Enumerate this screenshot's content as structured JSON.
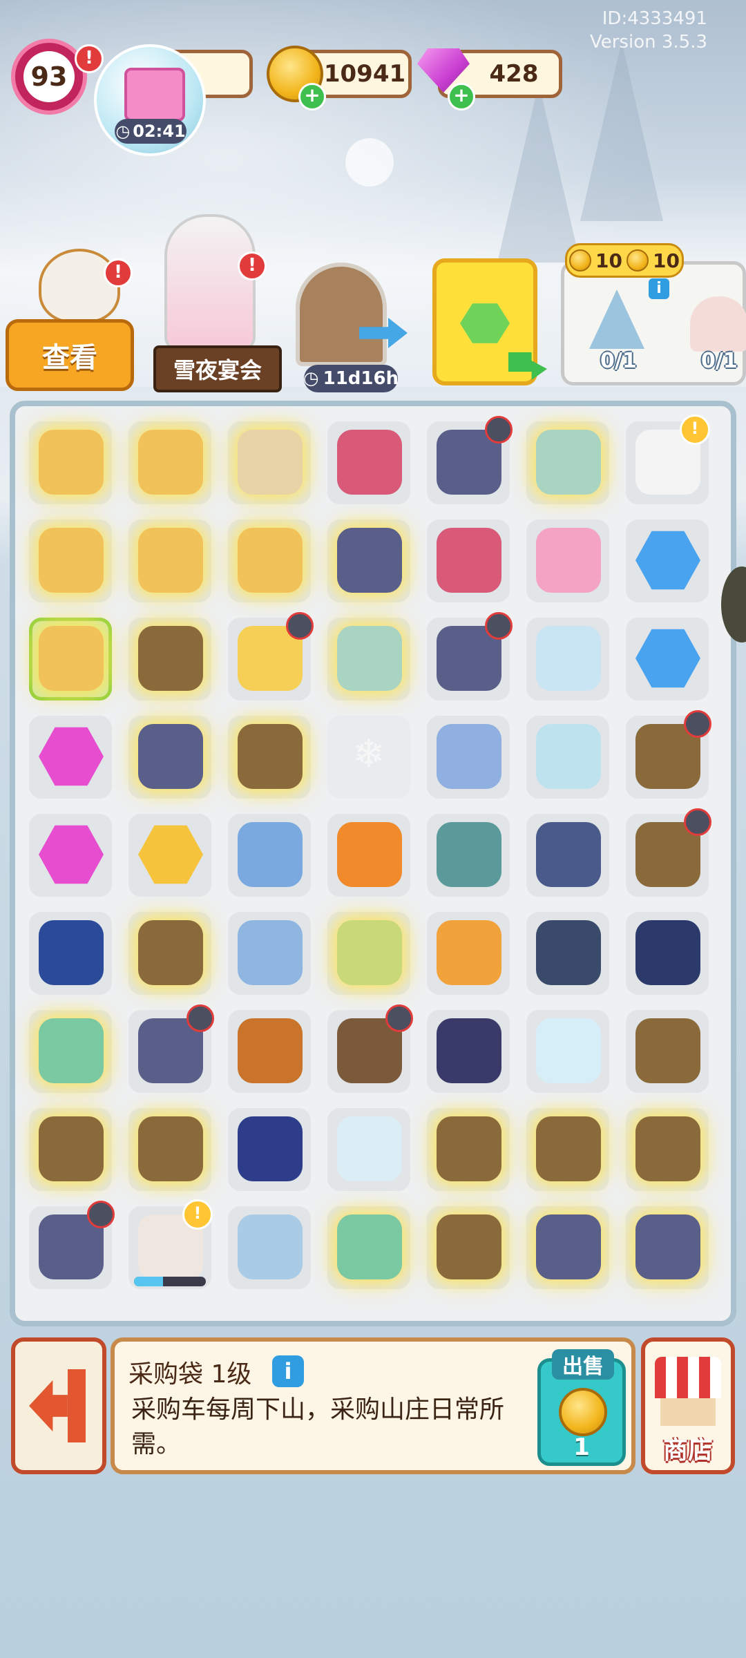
{
  "meta": {
    "id_text": "ID:4333491",
    "version_text": "Version 3.5.3"
  },
  "header": {
    "level": "93",
    "event_timer": "02:41",
    "coins": "10941",
    "gems": "428",
    "alert_mark": "!"
  },
  "row2": {
    "view_button": "查看",
    "event_sign": "雪夜宴会",
    "door_timer": "11d16h",
    "order_reward_a": "10",
    "order_reward_b": "10",
    "order_info": "i",
    "order_count_1": "0/1",
    "order_count_2": "0/1"
  },
  "board": {
    "rows": 9,
    "cols": 7
  },
  "bottom": {
    "title": "采购袋 1级",
    "info_icon": "i",
    "desc": "采购车每周下山，采购山庄日常所需。",
    "sell_label": "出售",
    "sell_value": "1",
    "shop_label": "商店"
  },
  "colors": {
    "accent_orange": "#f6a623",
    "board_border": "#a9c0cf",
    "sell_teal": "#35c9c9"
  }
}
